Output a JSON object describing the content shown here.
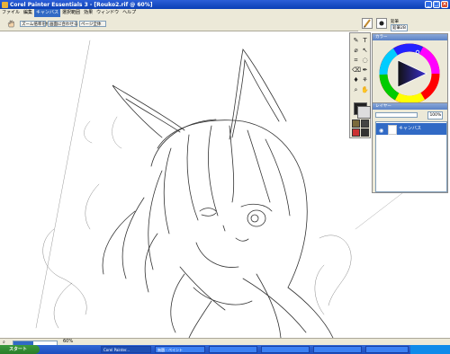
{
  "window": {
    "title": "Corel Painter Essentials 3 - [Rouko2.rif @ 60%]",
    "minimize": "_",
    "maximize": "□",
    "close": "×"
  },
  "menu": {
    "items": [
      "ファイル",
      "編集",
      "キャンバス",
      "選択範囲",
      "効果",
      "ウィンドウ",
      "ヘルプ"
    ],
    "active_index": 2,
    "file_label": "ファイル",
    "edit_label": "編集",
    "canvas_label": "キャンバス",
    "select_label": "選択範囲",
    "effects_label": "効果",
    "window_label": "ウィンドウ",
    "help_label": "ヘルプ"
  },
  "propbar": {
    "button1": "ズーム倍率を指定",
    "button2": "画面に合わせる",
    "button3": "ページ全体"
  },
  "brush": {
    "category": "鉛筆",
    "variant": "鉛筆2B"
  },
  "color_panel": {
    "title": "カラー"
  },
  "layers_panel": {
    "title": "レイヤー",
    "opacity": "100%",
    "layers": [
      "キャンバス"
    ]
  },
  "status": {
    "zoom": "60%",
    "zoom_fraction": 0.45
  },
  "taskbar": {
    "start": "スタート",
    "tasks": [
      "Corel Painter...",
      "無題 - ペイント",
      "",
      "",
      "",
      ""
    ],
    "clock": ""
  },
  "colors": {
    "accent": "#316ac5",
    "titlebar": "#0b3fb5",
    "panel_bg": "#ece9d8"
  }
}
